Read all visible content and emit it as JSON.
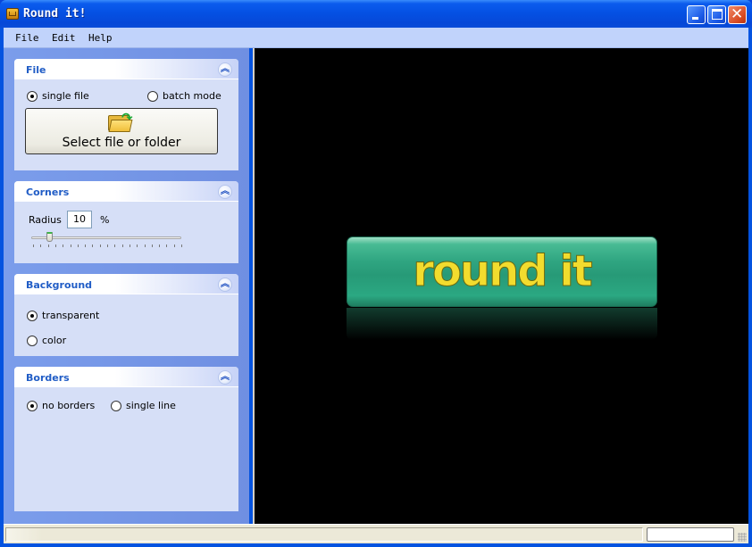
{
  "window": {
    "title": "Round it!"
  },
  "menu": [
    "File",
    "Edit",
    "Help"
  ],
  "panels": {
    "file": {
      "title": "File",
      "options": [
        {
          "label": "single file",
          "selected": true
        },
        {
          "label": "batch mode",
          "selected": false
        }
      ],
      "select_button": "Select file or folder"
    },
    "corners": {
      "title": "Corners",
      "radius_label": "Radius",
      "radius_value": "10",
      "unit": "%",
      "slider_value_percent": 10
    },
    "background": {
      "title": "Background",
      "options": [
        {
          "label": "transparent",
          "selected": true
        },
        {
          "label": "color",
          "selected": false
        }
      ]
    },
    "borders": {
      "title": "Borders",
      "options": [
        {
          "label": "no borders",
          "selected": true
        },
        {
          "label": "single line",
          "selected": false
        }
      ]
    }
  },
  "preview": {
    "logo_text": "round it",
    "button_color": "#2fa581",
    "text_color": "#f2dc2e"
  },
  "statusbar": {
    "text": "",
    "progress_percent": 0
  }
}
